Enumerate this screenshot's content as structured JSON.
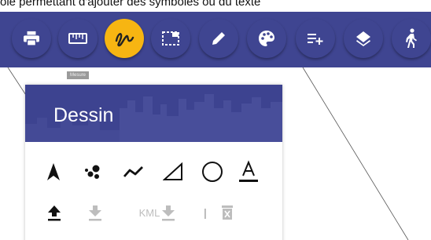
{
  "top_text": "ole permettant d'ajouter des symboles ou du texte",
  "toolbar": {
    "buttons": [
      {
        "name": "print",
        "icon": "printer-icon"
      },
      {
        "name": "measure",
        "icon": "ruler-icon"
      },
      {
        "name": "draw",
        "icon": "freehand-draw-icon",
        "active": true
      },
      {
        "name": "select-area",
        "icon": "dashed-selection-icon"
      },
      {
        "name": "annotate",
        "icon": "pencil-icon"
      },
      {
        "name": "style",
        "icon": "palette-icon"
      },
      {
        "name": "add-list",
        "icon": "playlist-add-icon"
      },
      {
        "name": "layers",
        "icon": "layers-icon"
      },
      {
        "name": "street-view",
        "icon": "walking-person-icon"
      }
    ],
    "accent_color": "#3f4591",
    "active_color": "#f7b512"
  },
  "tooltip": {
    "text": "Mesure"
  },
  "panel": {
    "title": "Dessin",
    "tools": [
      "arrow-pointer-icon",
      "points-icon",
      "polyline-icon",
      "triangle-icon",
      "circle-icon",
      "text-underline-icon"
    ],
    "actions": {
      "upload_icon": "upload-icon",
      "download_icon": "download-icon",
      "kml_label": "KML",
      "kml_icon": "download-icon",
      "separator": "|",
      "delete_icon": "trash-icon"
    }
  }
}
